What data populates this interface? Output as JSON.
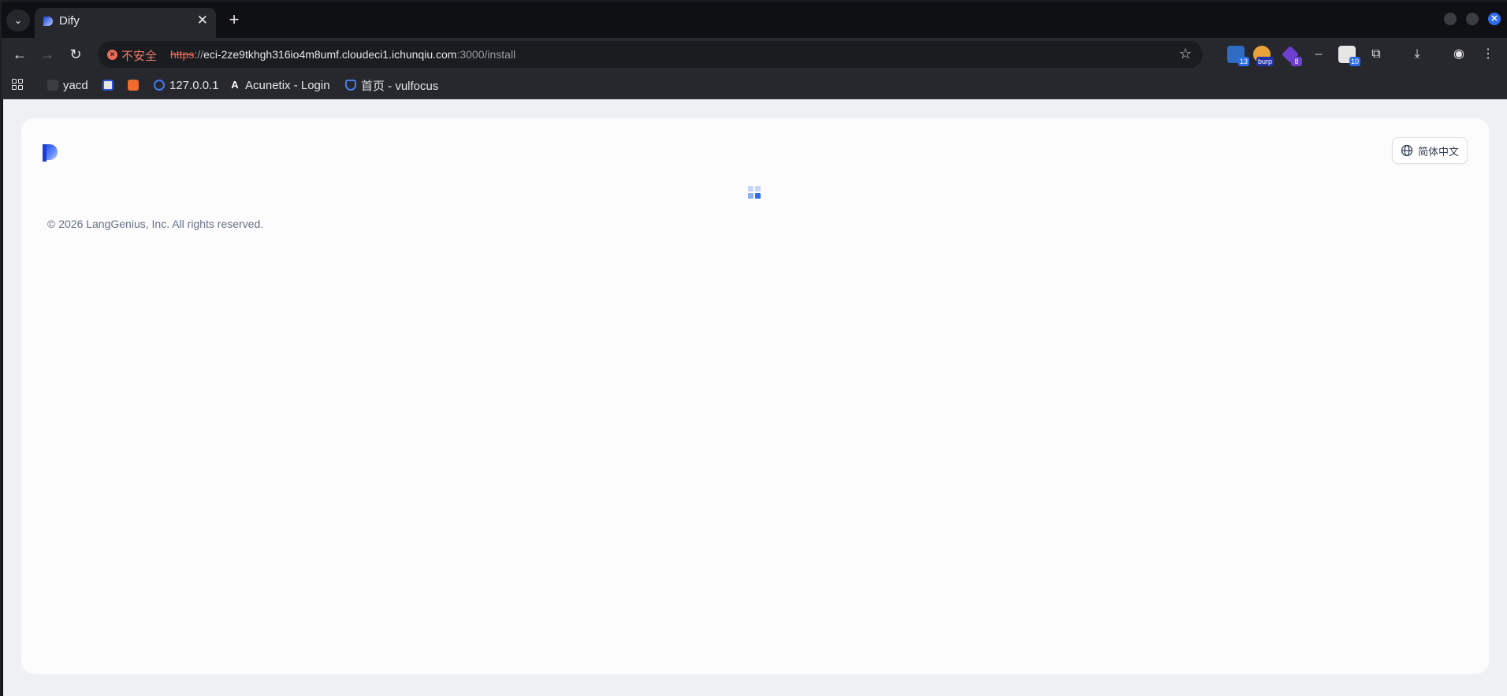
{
  "browser": {
    "tab": {
      "title": "Dify"
    },
    "address": {
      "security_label": "不安全",
      "scheme": "https",
      "separator": "://",
      "host": "eci-2ze9tkhgh316io4m8umf.cloudeci1.ichunqiu.com",
      "rest": ":3000/install"
    },
    "extensions": [
      {
        "icon": "calendar-ext-icon",
        "badge": "13"
      },
      {
        "icon": "burp-ext-icon",
        "badge": "burp"
      },
      {
        "icon": "cube-ext-icon",
        "badge": "8"
      },
      {
        "icon": "dash-ext-icon",
        "badge": ""
      },
      {
        "icon": "calendar2-ext-icon",
        "badge": "10"
      }
    ],
    "bookmarks": [
      {
        "label": "yacd",
        "icon": "cat-icon"
      },
      {
        "label": "",
        "icon": "blue-bookmark-icon"
      },
      {
        "label": "",
        "icon": "orange-bookmark-icon"
      },
      {
        "label": "127.0.0.1",
        "icon": "circle-bookmark-icon"
      },
      {
        "label": "Acunetix - Login",
        "icon": "acunetix-icon"
      },
      {
        "label": "首页 - vulfocus",
        "icon": "shield-bookmark-icon"
      }
    ]
  },
  "page": {
    "language_button": "简体中文",
    "footer": "© 2026 LangGenius, Inc. All rights reserved."
  },
  "colors": {
    "accent": "#2f6cf0",
    "card": "#fcfcfd",
    "page_bg": "#eff0f4"
  }
}
